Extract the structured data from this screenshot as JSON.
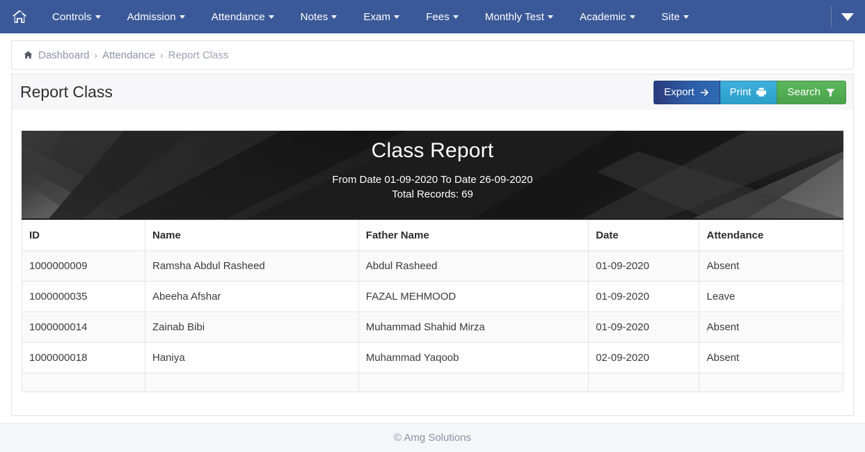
{
  "navbar": {
    "home_icon": "home-icon",
    "items": [
      {
        "label": "Controls",
        "has_caret": true
      },
      {
        "label": "Admission",
        "has_caret": true
      },
      {
        "label": "Attendance",
        "has_caret": true
      },
      {
        "label": "Notes",
        "has_caret": true
      },
      {
        "label": "Exam",
        "has_caret": true
      },
      {
        "label": "Fees",
        "has_caret": true
      },
      {
        "label": "Monthly Test",
        "has_caret": true
      },
      {
        "label": "Academic",
        "has_caret": true
      },
      {
        "label": "Site",
        "has_caret": true
      }
    ],
    "right_caret_icon": "caret-down-icon",
    "background_color": "#3b5998"
  },
  "breadcrumb": {
    "home_icon": "home-icon",
    "items": [
      {
        "label": "Dashboard",
        "active": false
      },
      {
        "label": "Attendance",
        "active": false
      },
      {
        "label": "Report Class",
        "active": true
      }
    ],
    "separator": "›"
  },
  "page_header": {
    "title": "Report Class",
    "buttons": [
      {
        "label": "Export",
        "icon": "arrow-right-icon",
        "color": "#2b3a7a"
      },
      {
        "label": "Print",
        "icon": "printer-icon",
        "color": "#2c9ec9"
      },
      {
        "label": "Search",
        "icon": "filter-icon",
        "color": "#5cb85c"
      }
    ]
  },
  "report": {
    "title": "Class Report",
    "date_range": "From Date 01-09-2020 To Date 26-09-2020",
    "total_records": "Total Records: 69"
  },
  "table": {
    "columns": [
      "ID",
      "Name",
      "Father Name",
      "Date",
      "Attendance"
    ],
    "rows": [
      {
        "id": "1000000009",
        "name": "Ramsha Abdul Rasheed",
        "father_name": "Abdul Rasheed",
        "date": "01-09-2020",
        "attendance": "Absent"
      },
      {
        "id": "1000000035",
        "name": "Abeeha Afshar",
        "father_name": "FAZAL MEHMOOD",
        "date": "01-09-2020",
        "attendance": "Leave"
      },
      {
        "id": "1000000014",
        "name": "Zainab Bibi",
        "father_name": "Muhammad Shahid Mirza",
        "date": "01-09-2020",
        "attendance": "Absent"
      },
      {
        "id": "1000000018",
        "name": "Haniya",
        "father_name": "Muhammad Yaqoob",
        "date": "02-09-2020",
        "attendance": "Absent"
      },
      {
        "id": "",
        "name": "",
        "father_name": "",
        "date": "",
        "attendance": ""
      }
    ]
  },
  "footer": {
    "copyright": "© Amg Solutions"
  }
}
